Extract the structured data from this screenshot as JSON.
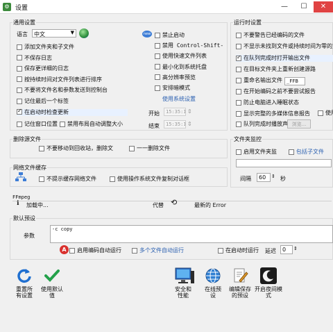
{
  "window": {
    "title": "设置",
    "minimize": "—",
    "maximize": "☐",
    "close": "✕"
  },
  "general": {
    "title": "通用设置",
    "language_label": "语言",
    "language_value": "中文",
    "left_options": [
      {
        "label": "添加文件夹和子文件",
        "checked": false
      },
      {
        "label": "不保存日志",
        "checked": false
      },
      {
        "label": "保存更详细的日志",
        "checked": false
      },
      {
        "label": "按持续时间对文件列表进行排序",
        "checked": false
      },
      {
        "label": "不要将文件名和参数发送到控制台",
        "checked": false
      },
      {
        "label": "记住最后一个标签",
        "checked": false
      },
      {
        "label": "在启动时检查更新",
        "checked": true
      }
    ],
    "remember_window_pos": "记住窗口位置",
    "disable_auto_layout": "禁用布局自动调整大小",
    "right_options": [
      {
        "label": "禁止启动",
        "checked": false,
        "mono": false
      },
      {
        "label": "禁用 Control-Shift-P",
        "checked": false,
        "mono": true
      },
      {
        "label": "使用快速文件列表",
        "checked": false,
        "mono": false
      },
      {
        "label": "最小化到系统托盘",
        "checked": false,
        "mono": false
      },
      {
        "label": "高分辨率预览",
        "checked": false,
        "mono": false
      },
      {
        "label": "安排暗模式",
        "checked": false,
        "mono": false
      }
    ],
    "system_settings_link": "使用系统设置",
    "start_label": "开始",
    "start_time": "15:35:1",
    "end_label": "结束",
    "end_time": "15:35:1"
  },
  "runtime": {
    "title": "运行时设置",
    "options": [
      {
        "label": "不要警告已经编码的文件",
        "checked": false
      },
      {
        "label": "不显示未找到文件或持续时间为零的文",
        "checked": false
      },
      {
        "label": "在队列完成时打开输出文件",
        "checked": true
      },
      {
        "label": "在目标文件夹上重新创建源路",
        "checked": false
      },
      {
        "label": "重命名输出文件",
        "checked": false
      },
      {
        "label": "在开始编码之前不要尝试报告",
        "checked": false
      },
      {
        "label": "防止电脑进入睡眠状态",
        "checked": false
      },
      {
        "label": "显示完整的多媒体信息报告",
        "checked": false
      },
      {
        "label": "队列完成时播放声音",
        "checked": false
      }
    ],
    "rename_value": "_FFB",
    "use_label": "使用",
    "browse_label": "浏览..."
  },
  "delete_source": {
    "title": "删除源文件",
    "opt1": "不要移动到回收站，删除文",
    "opt2": "一一删除文件"
  },
  "folder_monitor": {
    "title": "文件夹监控",
    "enable": "启用文件夹监",
    "include_subfolders": "包括子文件",
    "interval_label": "间隔",
    "interval_value": "60",
    "unit": "秒"
  },
  "network_cache": {
    "title": "网络文件缓存",
    "opt1": "不提示缓存网络文件",
    "opt2": "使用操作系统文件复制对话框"
  },
  "ffmpeg": {
    "title": "FFmpeg",
    "loading": "加载中...",
    "replace": "代替",
    "latest_error": "最新的 Error"
  },
  "default_preset": {
    "title": "默认预设",
    "params_label": "参数",
    "params_value": "-c copy",
    "enable_encode": "启用编码自动运行",
    "multi_auto": "多个文件自动运行",
    "run_on_start": "在启动时运行",
    "delay_label": "延迟",
    "delay_value": "0"
  },
  "bottom_buttons": [
    {
      "name": "reset-button",
      "label": "重置所\n有设置",
      "icon": "reset-icon"
    },
    {
      "name": "use-default-button",
      "label": "使用默认\n值",
      "icon": "checkmark-icon"
    },
    {
      "name": "security-performance-button",
      "label": "安全和\n性能",
      "icon": "monitor-icon"
    },
    {
      "name": "online-presets-button",
      "label": "在线预\n设",
      "icon": "globe-icon"
    },
    {
      "name": "edit-saved-presets-button",
      "label": "编辑保存\n的预设",
      "icon": "document-edit-icon"
    },
    {
      "name": "dark-mode-button",
      "label": "开启夜间模\n式",
      "icon": "moon-icon"
    }
  ],
  "colors": {
    "checked_row_bg": "#e8f1ff",
    "link": "#2a5fb0",
    "close": "#e04343"
  }
}
